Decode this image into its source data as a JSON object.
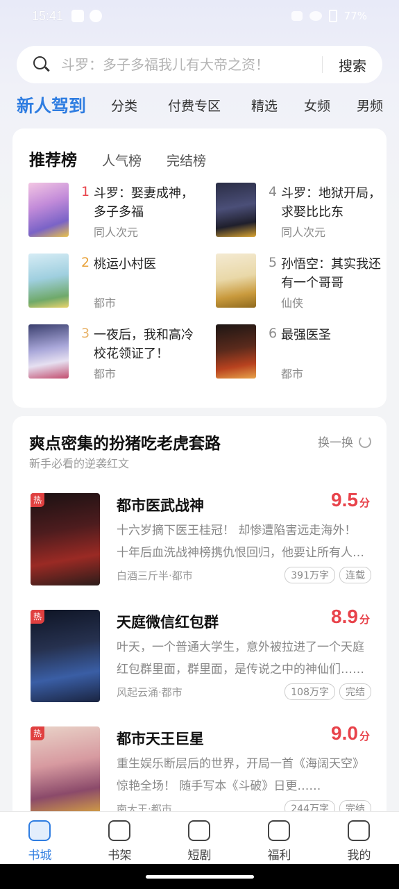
{
  "status_bar": {
    "time": "15:41",
    "battery": "77%"
  },
  "search": {
    "placeholder": "斗罗：多子多福我儿有大帝之资！",
    "button": "搜索"
  },
  "category_tabs": [
    "新人驾到",
    "分类",
    "付费专区",
    "精选",
    "女频",
    "男频"
  ],
  "ranking": {
    "tabs": [
      "推荐榜",
      "人气榜",
      "完结榜"
    ],
    "items": [
      {
        "rank": "1",
        "title": "斗罗：娶妻成神，多子多福",
        "genre": "同人次元"
      },
      {
        "rank": "2",
        "title": "桃运小村医",
        "genre": "都市"
      },
      {
        "rank": "3",
        "title": "一夜后，我和高冷校花领证了！",
        "genre": "都市"
      },
      {
        "rank": "4",
        "title": "斗罗：地狱开局，求娶比比东",
        "genre": "同人次元"
      },
      {
        "rank": "5",
        "title": "孙悟空：其实我还有一个哥哥",
        "genre": "仙侠"
      },
      {
        "rank": "6",
        "title": "最强医圣",
        "genre": "都市"
      }
    ]
  },
  "recommend": {
    "title": "爽点密集的扮猪吃老虎套路",
    "subtitle": "新手必看的逆袭红文",
    "refresh_label": "换一换",
    "books": [
      {
        "badge": "热",
        "title": "都市医武战神",
        "score": "9.5",
        "score_unit": "分",
        "description": "十六岁摘下医王桂冠！ 却惨遭陷害远走海外！ 十年后血洗战神榜携仇恨回归，他要让所有人付出代价！",
        "meta": "白酒三斤半·都市",
        "tags": [
          "391万字",
          "连载"
        ]
      },
      {
        "badge": "热",
        "title": "天庭微信红包群",
        "score": "8.9",
        "score_unit": "分",
        "description": "叶天，一个普通大学生，意外被拉进了一个天庭红包群里面，群里面，是传说之中的神仙们……",
        "meta": "风起云涌·都市",
        "tags": [
          "108万字",
          "完结"
        ]
      },
      {
        "badge": "热",
        "title": "都市天王巨星",
        "score": "9.0",
        "score_unit": "分",
        "description": "重生娱乐断层后的世界，开局一首《海阔天空》惊艳全场！ 随手写本《斗破》日更……",
        "meta": "南大王·都市",
        "tags": [
          "244万字",
          "完结"
        ]
      }
    ]
  },
  "bottom_nav": [
    "书城",
    "书架",
    "短剧",
    "福利",
    "我的"
  ],
  "colors": {
    "accent": "#2f7de1",
    "score": "#e8434b",
    "hot": "#e04040"
  }
}
